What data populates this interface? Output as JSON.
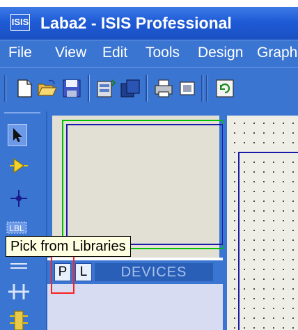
{
  "window": {
    "icon_text": "ISIS",
    "title": "Laba2 - ISIS Professional"
  },
  "menu": {
    "items": [
      "File",
      "View",
      "Edit",
      "Tools",
      "Design",
      "Graph"
    ]
  },
  "toolbar": {
    "buttons": [
      "new-file-icon",
      "open-folder-icon",
      "save-icon",
      "import-section-icon",
      "export-section-icon",
      "print-icon",
      "printer-setup-icon",
      "refresh-icon"
    ]
  },
  "tools": [
    "selection-mode-icon",
    "component-mode-icon",
    "junction-dot-icon",
    "wire-label-icon",
    "text-script-icon",
    "bus-icon",
    "subcircuit-icon"
  ],
  "tooltip": {
    "text": "Pick from Libraries"
  },
  "device_selector": {
    "pick_label": "P",
    "library_label": "L",
    "title": "DEVICES"
  },
  "colors": {
    "title_bar": "#1f5bd6",
    "panel": "#3b75d2",
    "overview_bg": "#e2e0d4",
    "sheet_green": "#00c000",
    "sheet_blue": "#1a1aa8",
    "highlight": "#ff2020"
  }
}
